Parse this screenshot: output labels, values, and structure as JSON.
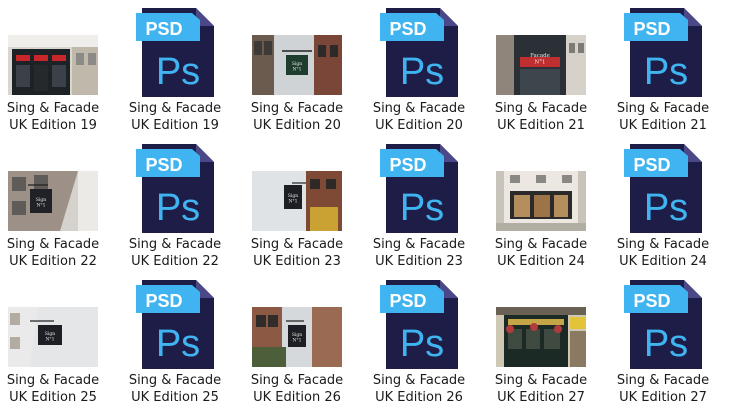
{
  "psd_icon": {
    "badge_text": "PSD",
    "mark_text": "Ps",
    "badge_color": "#3fb4f0",
    "body_color": "#1e1d48",
    "mark_color": "#3fb4f0"
  },
  "files": [
    {
      "kind": "thumb",
      "variant": 1,
      "line1": "Sing & Facade",
      "line2": "UK Edition 19",
      "sign": ""
    },
    {
      "kind": "psd",
      "line1": "Sing & Facade",
      "line2": "UK Edition 19"
    },
    {
      "kind": "thumb",
      "variant": 2,
      "line1": "Sing & Facade",
      "line2": "UK Edition 20",
      "sign": "Sign N°1"
    },
    {
      "kind": "psd",
      "line1": "Sing & Facade",
      "line2": "UK Edition 20"
    },
    {
      "kind": "thumb",
      "variant": 3,
      "line1": "Sing & Facade",
      "line2": "UK Edition 21",
      "sign": "Facade N°1"
    },
    {
      "kind": "psd",
      "line1": "Sing & Facade",
      "line2": "UK Edition 21"
    },
    {
      "kind": "thumb",
      "variant": 4,
      "line1": "Sing & Facade",
      "line2": "UK Edition 22",
      "sign": "Sign N°1"
    },
    {
      "kind": "psd",
      "line1": "Sing & Facade",
      "line2": "UK Edition 22"
    },
    {
      "kind": "thumb",
      "variant": 5,
      "line1": "Sing & Facade",
      "line2": "UK Edition 23",
      "sign": "Sign N°1"
    },
    {
      "kind": "psd",
      "line1": "Sing & Facade",
      "line2": "UK Edition 23"
    },
    {
      "kind": "thumb",
      "variant": 6,
      "line1": "Sing & Facade",
      "line2": "UK Edition 24",
      "sign": ""
    },
    {
      "kind": "psd",
      "line1": "Sing & Facade",
      "line2": "UK Edition 24"
    },
    {
      "kind": "thumb",
      "variant": 7,
      "line1": "Sing & Facade",
      "line2": "UK Edition 25",
      "sign": "Sign N°1"
    },
    {
      "kind": "psd",
      "line1": "Sing & Facade",
      "line2": "UK Edition 25"
    },
    {
      "kind": "thumb",
      "variant": 8,
      "line1": "Sing & Facade",
      "line2": "UK Edition 26",
      "sign": "Sign N°1"
    },
    {
      "kind": "psd",
      "line1": "Sing & Facade",
      "line2": "UK Edition 26"
    },
    {
      "kind": "thumb",
      "variant": 9,
      "line1": "Sing & Facade",
      "line2": "UK Edition 27",
      "sign": ""
    },
    {
      "kind": "psd",
      "line1": "Sing & Facade",
      "line2": "UK Edition 27"
    }
  ]
}
